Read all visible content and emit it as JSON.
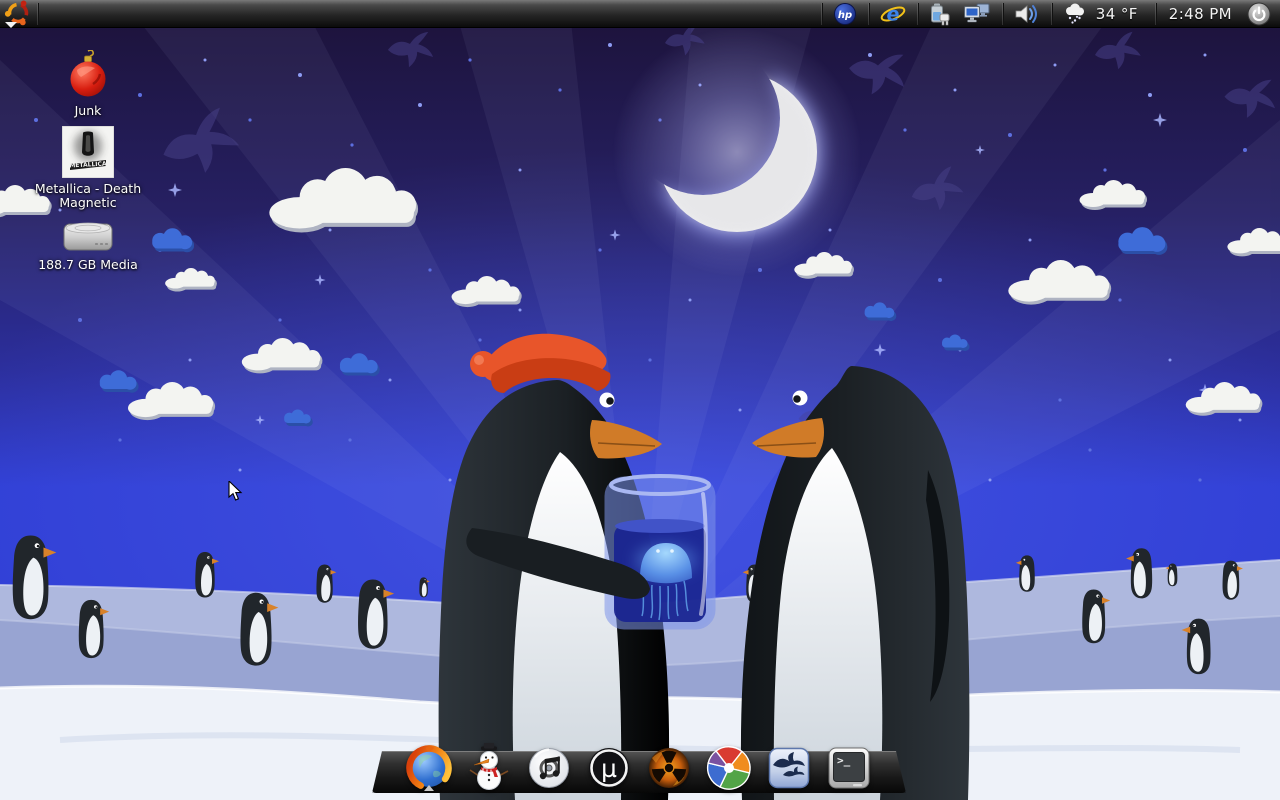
{
  "panel": {
    "time": "2:48 PM",
    "temperature": "34 °F",
    "hp_label": "hp",
    "ie_label": "e",
    "tray_icons": [
      "hp",
      "internet-explorer",
      "battery-plug",
      "network-computers",
      "volume",
      "weather-snow",
      "power"
    ]
  },
  "desktop_icons": [
    {
      "label": "Junk",
      "icon": "christmas-ornament"
    },
    {
      "label": "Metallica - Death Magnetic",
      "icon": "album-cover",
      "art_text": "METALLICA"
    },
    {
      "label": "188.7 GB Media",
      "icon": "hard-drive"
    }
  ],
  "dock": {
    "items": [
      {
        "name": "firefox"
      },
      {
        "name": "snowman"
      },
      {
        "name": "cd-music"
      },
      {
        "name": "utorrent",
        "glyph": "µ"
      },
      {
        "name": "radiation"
      },
      {
        "name": "picasa"
      },
      {
        "name": "openoffice"
      },
      {
        "name": "terminal",
        "glyph": ">_"
      }
    ]
  },
  "wallpaper": {
    "theme": "christmas-penguins-night",
    "colors": {
      "sky_top": "#1c1238",
      "sky_mid": "#262063",
      "sky_horizon": "#3140d6",
      "snow_back": "#aab4de",
      "snow_mid": "#98a4d2",
      "snow_front": "#eef2f9",
      "hat_red": "#e54a1e",
      "jar_blue": "#1a2590",
      "jelly_glow": "#8fd0ff",
      "moon": "#efeff0"
    }
  }
}
